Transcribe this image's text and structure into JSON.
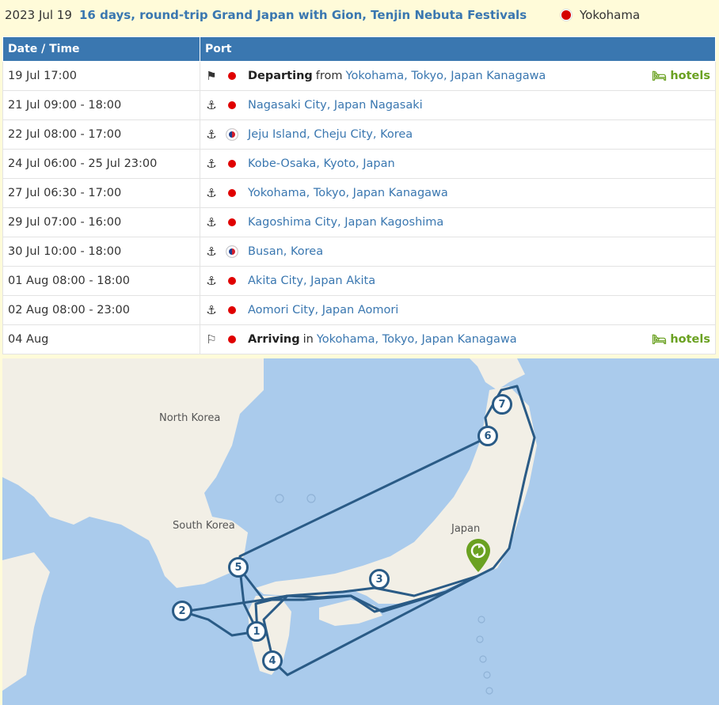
{
  "header": {
    "date": "2023 Jul 19",
    "title": "16 days, round-trip Grand Japan with Gion, Tenjin Nebuta Festivals",
    "home_port": "Yokohama"
  },
  "table": {
    "headers": [
      "Date / Time",
      "Port"
    ],
    "rows": [
      {
        "date": "19 Jul 17:00",
        "icon": "flag-icon",
        "flag": "jp",
        "prefix": "Departing",
        "joiner": "from",
        "port": "Yokohama, Tokyo, Japan Kanagawa",
        "hotels": "hotels"
      },
      {
        "date": "21 Jul 09:00 - 18:00",
        "icon": "anchor-icon",
        "flag": "jp",
        "port": "Nagasaki City, Japan Nagasaki"
      },
      {
        "date": "22 Jul 08:00 - 17:00",
        "icon": "anchor-icon",
        "flag": "kr",
        "port": "Jeju Island, Cheju City, Korea"
      },
      {
        "date": "24 Jul 06:00 - 25 Jul 23:00",
        "icon": "anchor-icon",
        "flag": "jp",
        "port": "Kobe-Osaka, Kyoto, Japan"
      },
      {
        "date": "27 Jul 06:30 - 17:00",
        "icon": "anchor-icon",
        "flag": "jp",
        "port": "Yokohama, Tokyo, Japan Kanagawa"
      },
      {
        "date": "29 Jul 07:00 - 16:00",
        "icon": "anchor-icon",
        "flag": "jp",
        "port": "Kagoshima City, Japan Kagoshima"
      },
      {
        "date": "30 Jul 10:00 - 18:00",
        "icon": "anchor-icon",
        "flag": "kr",
        "port": "Busan, Korea"
      },
      {
        "date": "01 Aug 08:00 - 18:00",
        "icon": "anchor-icon",
        "flag": "jp",
        "port": "Akita City, Japan Akita"
      },
      {
        "date": "02 Aug 08:00 - 23:00",
        "icon": "anchor-icon",
        "flag": "jp",
        "port": "Aomori City, Japan Aomori"
      },
      {
        "date": "04 Aug",
        "icon": "checkered-flag-icon",
        "flag": "jp",
        "prefix": "Arriving",
        "joiner": "in",
        "port": "Yokohama, Tokyo, Japan Kanagawa",
        "hotels": "hotels"
      }
    ]
  },
  "map": {
    "labels": {
      "north_korea": "North Korea",
      "south_korea": "South Korea",
      "japan": "Japan"
    },
    "markers": [
      "1",
      "2",
      "3",
      "4",
      "5",
      "6",
      "7"
    ],
    "colors": {
      "sea": "#aacbec",
      "land": "#f2efe6",
      "route": "#2a5b86",
      "pin": "#6aa121"
    }
  }
}
